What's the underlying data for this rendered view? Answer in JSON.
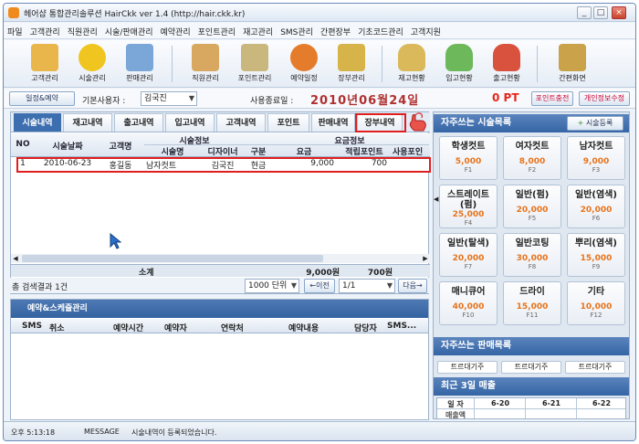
{
  "window": {
    "title": "헤어샵 통합관리솔루션 HairCkk ver 1.4 (http://hair.ckk.kr)",
    "min": "_",
    "max": "□",
    "close": "×"
  },
  "menu": [
    "파일",
    "고객관리",
    "직원관리",
    "시술/판매관리",
    "예약관리",
    "포인트관리",
    "재고관리",
    "SMS관리",
    "간편장부",
    "기초코드관리",
    "고객지원"
  ],
  "toolbar": [
    {
      "label": "고객관리",
      "icon": "customer-card-icon",
      "color": "#e8b64a"
    },
    {
      "label": "시술관리",
      "icon": "smiley-icon",
      "color": "#f0c51f"
    },
    {
      "label": "판매관리",
      "icon": "products-icon",
      "color": "#7aa6d8"
    },
    {
      "label": "직원관리",
      "icon": "staff-icon",
      "color": "#d8a860"
    },
    {
      "label": "포인트관리",
      "icon": "calculator-icon",
      "color": "#c9b77d"
    },
    {
      "label": "예약일정",
      "icon": "alarm-clock-icon",
      "color": "#e57c2b"
    },
    {
      "label": "장부관리",
      "icon": "ledger-icon",
      "color": "#d7b44a"
    },
    {
      "label": "재고현황",
      "icon": "database-icon",
      "color": "#d9b95a"
    },
    {
      "label": "입고현황",
      "icon": "database-add-icon",
      "color": "#6cb85a"
    },
    {
      "label": "출고현황",
      "icon": "database-remove-icon",
      "color": "#d9523e"
    },
    {
      "label": "간편화면",
      "icon": "monitor-icon",
      "color": "#c9a24a"
    }
  ],
  "infobar": {
    "schedule_btn": "일정&예약",
    "user_label": "기본사용자 :",
    "user_value": "김국진",
    "expiry_label": "사용종료일 :",
    "date": "2010년06월24일",
    "points": "0 PT",
    "point_charge": "포인트충전",
    "personal_info": "개인정보수정"
  },
  "tabs": [
    "시술내역",
    "재고내역",
    "출고내역",
    "입고내역",
    "고객내역",
    "포인트",
    "판매내역",
    "장부내역"
  ],
  "grid": {
    "headers": {
      "no": "NO",
      "date": "시술날짜",
      "customer": "고객명",
      "service_group": "시술정보",
      "service": "시술명",
      "designer": "디자이너",
      "kind": "구분",
      "fee_group": "요금정보",
      "fee": "요금",
      "acc_point": "적립포인트",
      "used_point": "사용포인"
    },
    "rows": [
      {
        "no": "1",
        "date": "2010-06-23",
        "customer": "홍길동",
        "service": "남자컷트",
        "designer": "김국진",
        "kind": "현금",
        "fee": "9,000",
        "point": "700"
      }
    ],
    "sum_label": "소계",
    "sum_fee": "9,000원",
    "sum_point": "700원"
  },
  "pager": {
    "result": "총 검색결과 1건",
    "per_page": "1000 단위",
    "prev": "←이전",
    "page": "1/1",
    "next": "다음→"
  },
  "reservation": {
    "title": "예약&스케쥴관리",
    "columns": [
      "SMS",
      "취소",
      "예약시간",
      "예약자",
      "연락처",
      "예약내용",
      "담당자",
      "SMS..."
    ]
  },
  "status": {
    "time": "오후 5:13:18",
    "type": "MESSAGE",
    "message": "시술내역이 등록되었습니다."
  },
  "favorites": {
    "title": "자주쓰는 시술목록",
    "register": "시술등록",
    "items": [
      {
        "name": "학생컷트",
        "price": "5,000",
        "key": "F1"
      },
      {
        "name": "여자컷트",
        "price": "8,000",
        "key": "F2"
      },
      {
        "name": "남자컷트",
        "price": "9,000",
        "key": "F3"
      },
      {
        "name": "스트레이트 (펌)",
        "price": "25,000",
        "key": "F4"
      },
      {
        "name": "일반(펌)",
        "price": "20,000",
        "key": "F5"
      },
      {
        "name": "일반(염색)",
        "price": "20,000",
        "key": "F6"
      },
      {
        "name": "일반(탈색)",
        "price": "20,000",
        "key": "F7"
      },
      {
        "name": "일반코팅",
        "price": "30,000",
        "key": "F8"
      },
      {
        "name": "뿌리(염색)",
        "price": "15,000",
        "key": "F9"
      },
      {
        "name": "매니큐어",
        "price": "40,000",
        "key": "F10"
      },
      {
        "name": "드라이",
        "price": "15,000",
        "key": "F11"
      },
      {
        "name": "기타",
        "price": "10,000",
        "key": "F12"
      }
    ]
  },
  "products": {
    "title": "자주쓰는 판매목록",
    "items": [
      "트르대기주",
      "트르대기주",
      "트르대기주"
    ]
  },
  "sales": {
    "title": "최근 3일 매출",
    "day_label": "일 자",
    "amount_label": "매출액",
    "days": [
      "6-20",
      "6-21",
      "6-22"
    ]
  }
}
